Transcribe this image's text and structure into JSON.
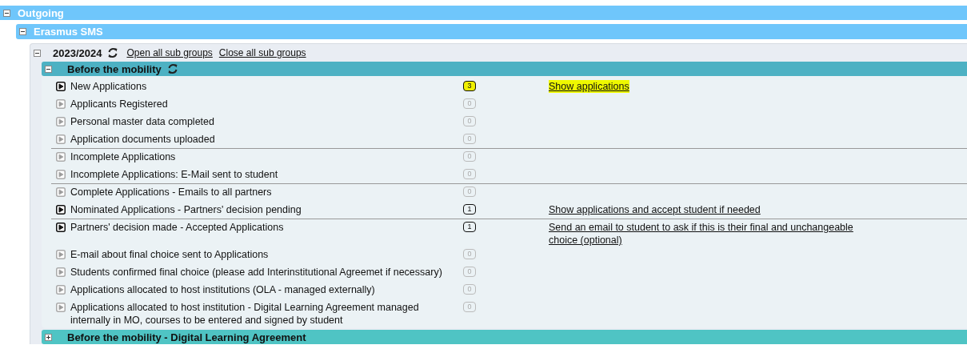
{
  "outgoing": {
    "title": "Outgoing",
    "expanded": true
  },
  "program": {
    "title": "Erasmus SMS",
    "expanded": true
  },
  "year": {
    "title": "2023/2024",
    "expanded": true,
    "links": [
      "Open all sub groups",
      "Close all sub groups"
    ]
  },
  "groups": [
    {
      "title": "Before the mobility",
      "expanded": true,
      "refresh": true,
      "rows": [
        {
          "label": "New Applications",
          "count": "3",
          "active": true,
          "highlighted": true,
          "divider_after": false,
          "link": "Show applications"
        },
        {
          "label": "Applicants Registered",
          "count": "0",
          "active": false,
          "highlighted": false,
          "divider_after": false
        },
        {
          "label": "Personal master data completed",
          "count": "0",
          "active": false,
          "highlighted": false,
          "divider_after": false
        },
        {
          "label": "Application documents uploaded",
          "count": "0",
          "active": false,
          "highlighted": false,
          "divider_after": true
        },
        {
          "label": "Incomplete Applications",
          "count": "0",
          "active": false,
          "highlighted": false,
          "divider_after": false
        },
        {
          "label": "Incomplete Applications: E-Mail sent to student",
          "count": "0",
          "active": false,
          "highlighted": false,
          "divider_after": true
        },
        {
          "label": "Complete Applications - Emails to all partners",
          "count": "0",
          "active": false,
          "highlighted": false,
          "divider_after": false
        },
        {
          "label": "Nominated Applications - Partners' decision pending",
          "count": "1",
          "active": true,
          "highlighted": false,
          "divider_after": true,
          "link": "Show applications and accept student if needed"
        },
        {
          "label": "Partners' decision made - Accepted Applications",
          "count": "1",
          "active": true,
          "highlighted": false,
          "divider_after": false,
          "link": "Send an email to student to ask if this is their final and unchangeable choice (optional)"
        },
        {
          "label": "E-mail about final choice sent to Applications",
          "count": "0",
          "active": false,
          "highlighted": false,
          "divider_after": false
        },
        {
          "label": "Students confirmed final choice (please add Interinstitutional Agreemet if necessary)",
          "count": "0",
          "active": false,
          "highlighted": false,
          "divider_after": false
        },
        {
          "label": "Applications allocated to host institutions (OLA - managed externally)",
          "count": "0",
          "active": false,
          "highlighted": false,
          "divider_after": false
        },
        {
          "label": "Applications allocated to host institution - Digital Learning Agreement managed internally in MO, courses to be entered and signed by student",
          "count": "0",
          "active": false,
          "highlighted": false,
          "divider_after": false
        }
      ]
    },
    {
      "title": "Before the mobility - Digital Learning Agreement",
      "expanded": false,
      "refresh": false
    }
  ]
}
